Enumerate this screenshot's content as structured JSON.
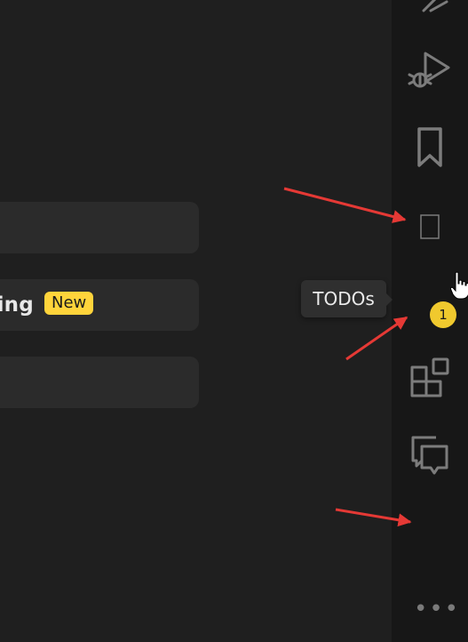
{
  "main": {
    "rows": [
      {
        "text": ""
      },
      {
        "text": "ning",
        "badge": "New"
      },
      {
        "text": ""
      }
    ]
  },
  "activity_bar": {
    "items": [
      {
        "name": "git-icon"
      },
      {
        "name": "run-debug-icon"
      },
      {
        "name": "bookmark-icon"
      },
      {
        "name": "empty-square-icon"
      },
      {
        "name": "todo-icon",
        "badge": "1"
      },
      {
        "name": "extensions-icon"
      },
      {
        "name": "comments-icon"
      },
      {
        "name": "blank-icon"
      }
    ],
    "more": "•••"
  },
  "tooltip": {
    "text": "TODOs"
  },
  "colors": {
    "background": "#1f1f1f",
    "activity_bar": "#171717",
    "icon": "#7c7c7c",
    "badge": "#f0c92e",
    "new_badge": "#ffd43b",
    "arrow": "#e53935"
  }
}
